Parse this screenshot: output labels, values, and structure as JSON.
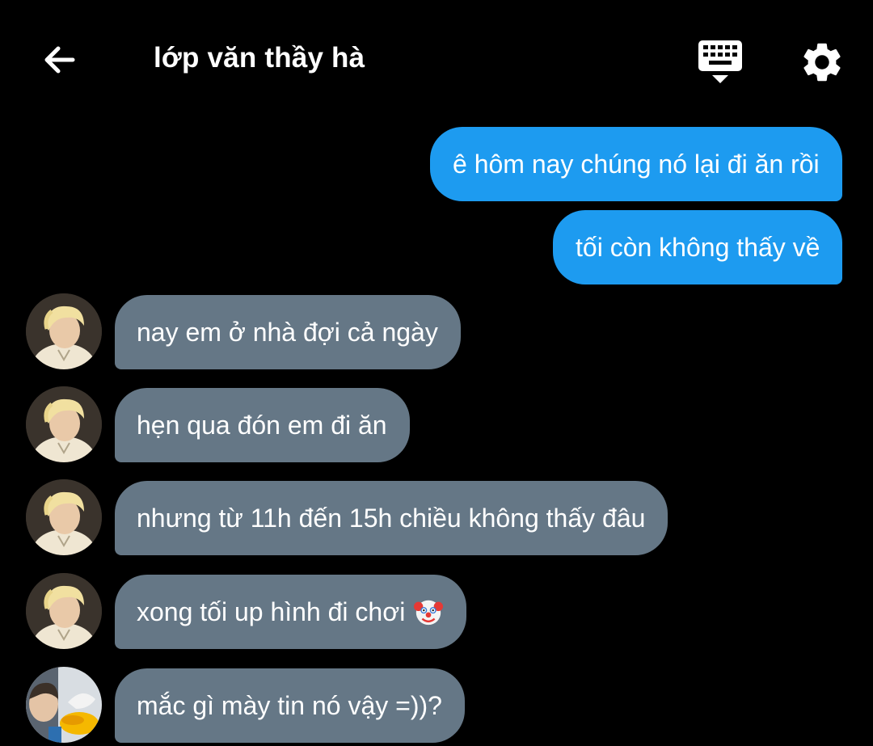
{
  "header": {
    "back_icon": "arrow-left-icon",
    "title": "lớp văn thầy hà",
    "keyboard_icon": "keyboard-hide-icon",
    "settings_icon": "gear-icon"
  },
  "messages": [
    {
      "side": "sent",
      "text": "ê hôm nay chúng nó lại đi ăn rồi"
    },
    {
      "side": "sent",
      "text": "tối còn không thấy về"
    },
    {
      "side": "received",
      "text": "nay em ở nhà đợi cả ngày"
    },
    {
      "side": "received",
      "text": "hẹn qua đón em đi ăn"
    },
    {
      "side": "received",
      "text": "nhưng từ 11h đến 15h chiều không thấy đâu"
    },
    {
      "side": "received",
      "text": "xong tối up hình đi chơi",
      "emoji": "clown-face-emoji"
    },
    {
      "side": "received",
      "text": "mắc gì mày tin nó vậy =))?"
    }
  ],
  "colors": {
    "background": "#000000",
    "sent_bubble": "#1d9bf0",
    "received_bubble": "#657786",
    "text": "#ffffff"
  }
}
